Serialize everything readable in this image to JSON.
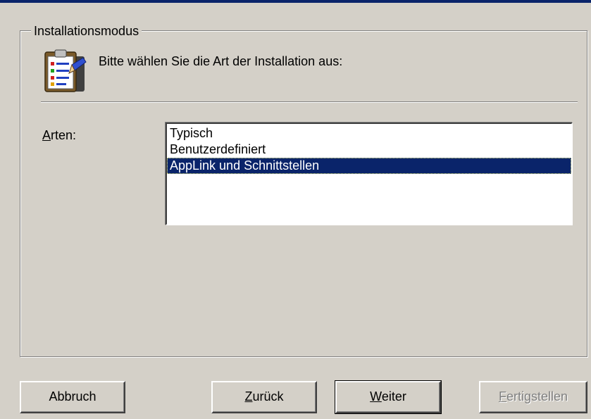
{
  "dialog": {
    "group_title": "Installationsmodus",
    "instruction": "Bitte wählen Sie die Art der Installation aus:",
    "header_icon": "clipboard-checklist-icon"
  },
  "types": {
    "label_accel": "A",
    "label_rest": "rten:",
    "items": [
      {
        "label": "Typisch",
        "selected": false
      },
      {
        "label": "Benutzerdefiniert",
        "selected": false
      },
      {
        "label": "AppLink und Schnittstellen",
        "selected": true
      }
    ]
  },
  "buttons": {
    "cancel": {
      "label": "Abbruch"
    },
    "back": {
      "accel": "Z",
      "rest": "urück"
    },
    "next": {
      "accel": "W",
      "rest": "eiter"
    },
    "finish": {
      "accel": "F",
      "rest": "ertigstellen",
      "enabled": false
    }
  },
  "colors": {
    "face": "#d4d0c8",
    "selection": "#0a246a",
    "shadow": "#808080",
    "highlight": "#ffffff"
  }
}
